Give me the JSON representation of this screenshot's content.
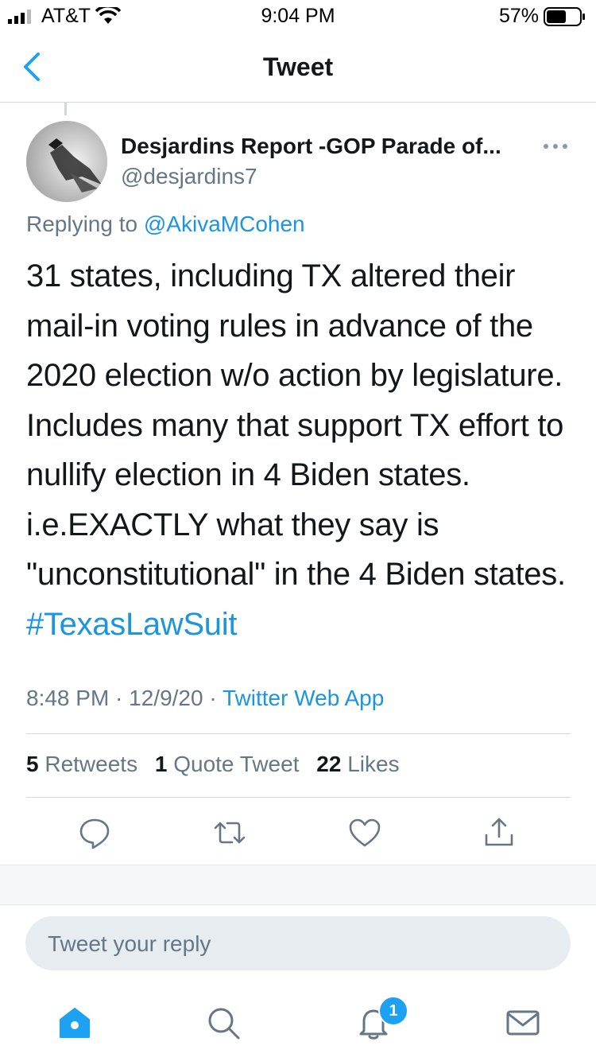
{
  "status_bar": {
    "carrier": "AT&T",
    "time": "9:04 PM",
    "battery": "57%"
  },
  "header": {
    "title": "Tweet"
  },
  "tweet": {
    "display_name": "Desjardins Report -GOP Parade of...",
    "handle": "@desjardins7",
    "replying_prefix": "Replying to ",
    "replying_to": "@AkivaMCohen",
    "text": "31 states, including TX altered their mail-in voting rules in advance of the 2020 election w/o action by legislature. Includes many that support TX effort to nullify election in 4 Biden states. i.e.EXACTLY what they say is \"unconstitutional\" in the 4 Biden states. ",
    "hashtag": "#TexasLawSuit",
    "timestamp": "8:48 PM · 12/9/20 · ",
    "source": "Twitter Web App",
    "stats": {
      "retweets_count": "5",
      "retweets_label": "Retweets",
      "quotes_count": "1",
      "quotes_label": "Quote Tweet",
      "likes_count": "22",
      "likes_label": "Likes"
    }
  },
  "actions": [
    "reply-icon",
    "retweet-icon",
    "like-icon",
    "share-icon"
  ],
  "reply_box": {
    "placeholder": "Tweet your reply"
  },
  "tab_bar": {
    "items": [
      "home-icon",
      "search-icon",
      "notifications-icon",
      "messages-icon"
    ],
    "notifications_badge": "1"
  },
  "colors": {
    "accent": "#1da1f2",
    "link": "#1b95e0",
    "secondary_text": "#657786"
  }
}
